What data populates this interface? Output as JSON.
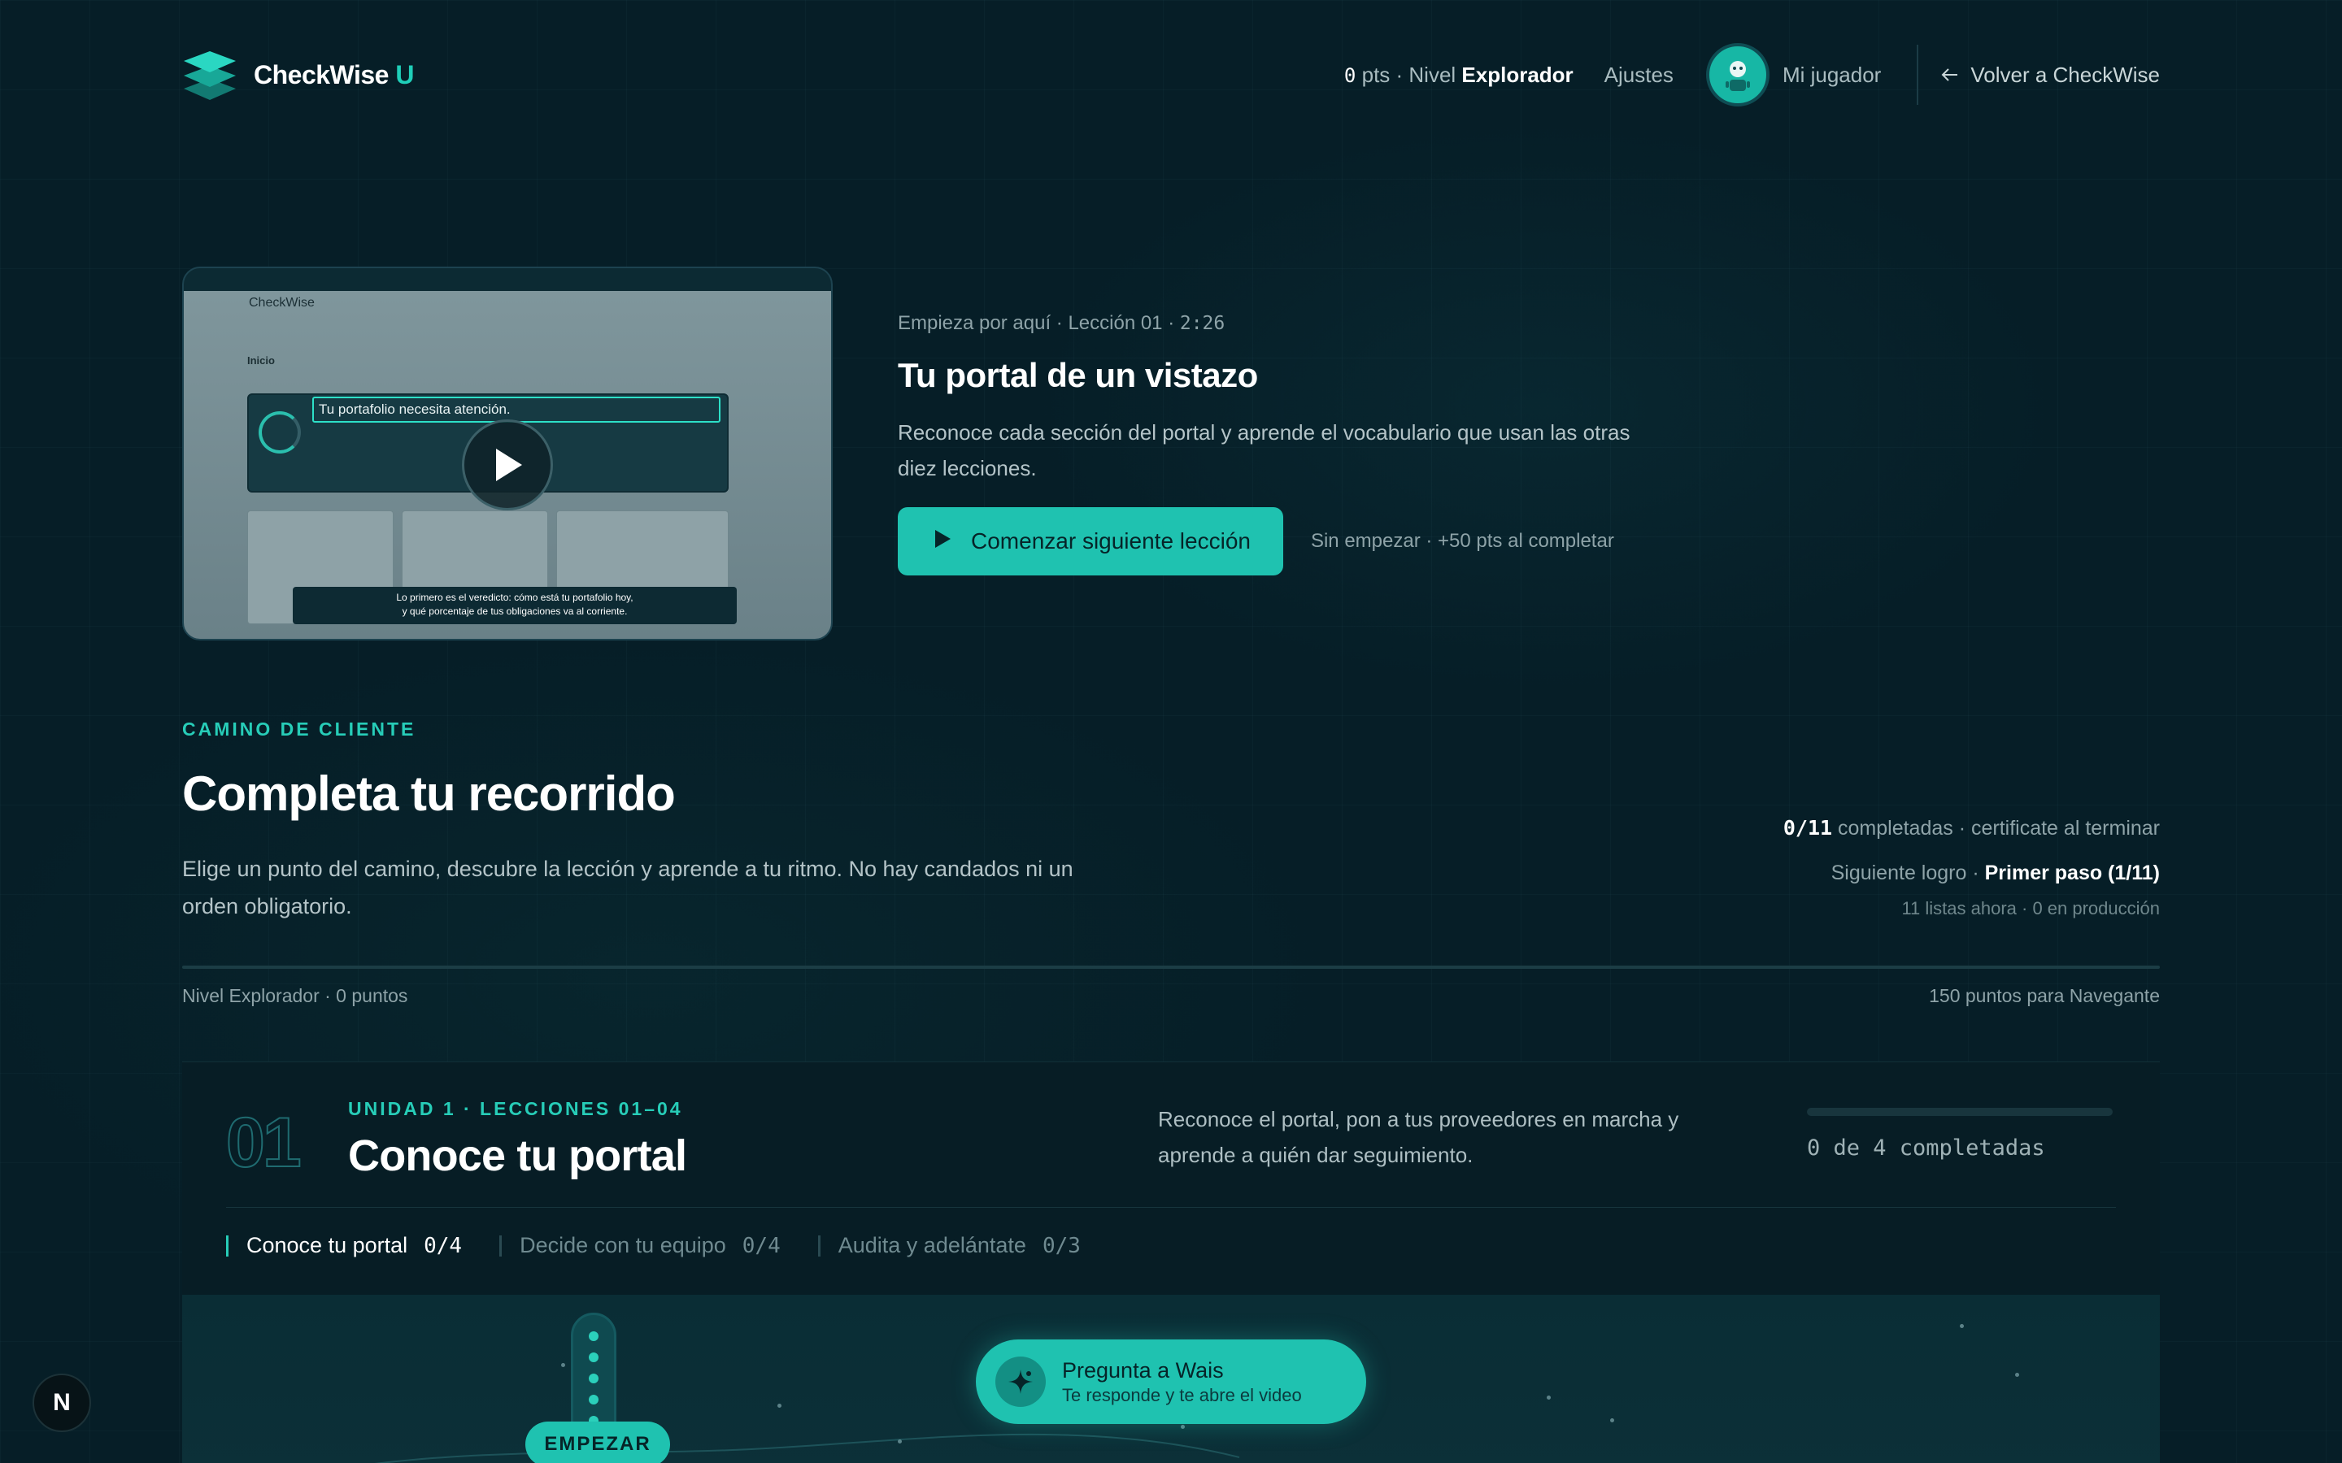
{
  "header": {
    "brand_name": "CheckWise",
    "brand_suffix": "U",
    "points_value": "0",
    "points_text": "pts · Nivel",
    "level_name": "Explorador",
    "settings_label": "Ajustes",
    "player_label": "Mi jugador",
    "back_label": "Volver a CheckWise"
  },
  "hero": {
    "video": {
      "screen_brand": "CheckWise",
      "screen_page": "Inicio",
      "screen_headline": "Tu portafolio necesita atención.",
      "caption_line1": "Lo primero es el veredicto: cómo está tu portafolio hoy,",
      "caption_line2": "y qué porcentaje de tus obligaciones va al corriente."
    },
    "kicker_text": "Empieza por aquí · Lección 01 ·",
    "kicker_duration": "2:26",
    "title": "Tu portal de un vistazo",
    "description": "Reconoce cada sección del portal y aprende el vocabulario que usan las otras diez lecciones.",
    "cta_label": "Comenzar siguiente lección",
    "cta_note": "Sin empezar · +50 pts al completar"
  },
  "path_section": {
    "eyebrow": "CAMINO DE CLIENTE",
    "title": "Completa tu recorrido",
    "description": "Elige un punto del camino, descubre la lección y aprende a tu ritmo. No hay candados ni un orden obligatorio.",
    "completed_value": "0/11",
    "completed_text": "completadas · certificate al terminar",
    "next_achievement_label": "Siguiente logro ·",
    "next_achievement_value": "Primer paso (1/11)",
    "availability_text": "11 listas ahora · 0 en producción",
    "level_left": "Nivel Explorador · 0 puntos",
    "level_right": "150 puntos para Navegante",
    "level_progress": 0
  },
  "unit": {
    "number": "01",
    "eyebrow": "UNIDAD 1 · LECCIONES 01–04",
    "title": "Conoce tu portal",
    "description": "Reconoce el portal, pon a tus proveedores en marcha y aprende a quién dar seguimiento.",
    "progress_text": "0 de 4 completadas",
    "progress_fraction": 0,
    "chapters": [
      {
        "label": "Conoce tu portal",
        "count": "0/4"
      },
      {
        "label": "Decide con tu equipo",
        "count": "0/4"
      },
      {
        "label": "Audita y adelántate",
        "count": "0/3"
      }
    ],
    "start_label": "EMPEZAR"
  },
  "assistant": {
    "title": "Pregunta a Wais",
    "subtitle": "Te responde y te abre el video"
  },
  "dev_badge": "N",
  "colors": {
    "accent": "#1fc2b0",
    "background": "#061e27",
    "eyebrow": "#27cdb8"
  },
  "icons": {
    "logo": "stacked-layers-icon",
    "back": "arrow-left-icon",
    "play": "play-icon",
    "assistant": "sparkle-icon",
    "avatar": "robot-avatar-icon"
  }
}
